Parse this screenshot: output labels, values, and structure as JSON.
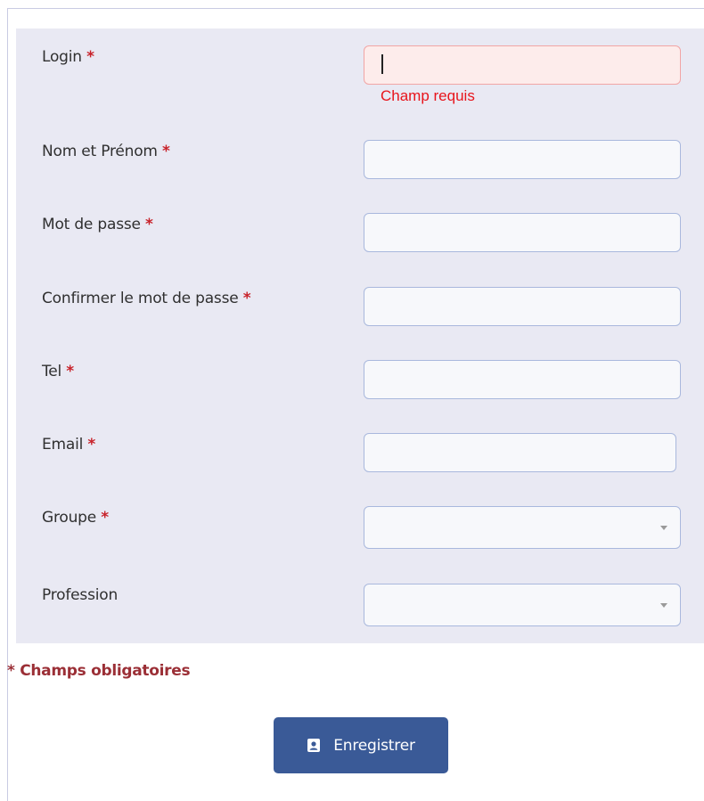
{
  "form": {
    "required_marker": "*",
    "fields": {
      "login": {
        "label": "Login",
        "value": "",
        "error": "Champ requis"
      },
      "nom_prenom": {
        "label": "Nom et Prénom",
        "value": ""
      },
      "mot_de_passe": {
        "label": "Mot de passe",
        "value": ""
      },
      "confirmer_mdp": {
        "label": "Confirmer le mot de passe",
        "value": ""
      },
      "tel": {
        "label": "Tel",
        "value": ""
      },
      "email": {
        "label": "Email",
        "value": ""
      },
      "groupe": {
        "label": "Groupe",
        "selected": ""
      },
      "profession": {
        "label": "Profession",
        "selected": ""
      }
    },
    "required_note": "* Champs obligatoires",
    "save_label": "Enregistrer"
  },
  "icons": {
    "save_button_icon": "contact-card-icon",
    "select_arrow": "caret-down-icon"
  },
  "colors": {
    "panel_bg": "#e9e9f3",
    "required_star": "#c8222a",
    "error_text": "#e8141b",
    "footnote_text": "#9b2f36",
    "button_bg": "#3a5a97"
  }
}
